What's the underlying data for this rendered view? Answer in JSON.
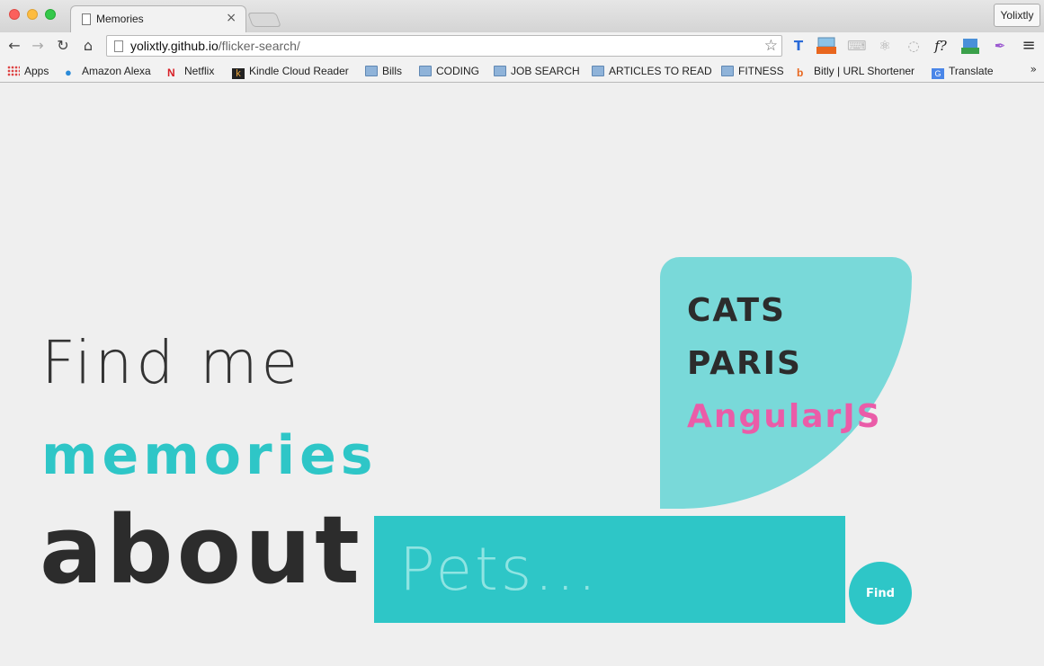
{
  "browser": {
    "tab_title": "Memories",
    "tab_close": "×",
    "profile_name": "Yolixtly",
    "url_host": "yolixtly.github.io",
    "url_path": "/flicker-search/",
    "bookmarks": [
      {
        "label": "Apps",
        "icon": "apps-grid-icon"
      },
      {
        "label": "Amazon Alexa",
        "icon": "alexa-icon"
      },
      {
        "label": "Netflix",
        "icon": "netflix-icon"
      },
      {
        "label": "Kindle Cloud Reader",
        "icon": "kindle-icon"
      },
      {
        "label": "Bills",
        "icon": "folder-icon"
      },
      {
        "label": "CODING",
        "icon": "folder-icon"
      },
      {
        "label": "JOB SEARCH",
        "icon": "folder-icon"
      },
      {
        "label": "ARTICLES TO READ",
        "icon": "folder-icon"
      },
      {
        "label": "FITNESS",
        "icon": "folder-icon"
      },
      {
        "label": "Bitly | URL Shortener",
        "icon": "bitly-icon"
      },
      {
        "label": "Translate",
        "icon": "translate-icon"
      }
    ],
    "more": "»"
  },
  "page": {
    "line1": "Find me",
    "line2": "memories",
    "line3": "about",
    "search_placeholder": "Pets...",
    "find_label": "Find",
    "suggestions": [
      "CATS",
      "PARIS",
      "AngularJS"
    ]
  },
  "colors": {
    "teal": "#2ec6c7",
    "light_teal": "#79d9d9",
    "pink": "#ea5ca8",
    "dark": "#2c2c2c",
    "background": "#efefef"
  }
}
